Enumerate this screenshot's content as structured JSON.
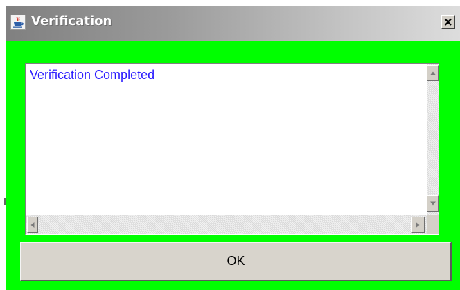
{
  "window": {
    "title": "Verification",
    "icon": "java-cup-icon",
    "background_color": "#00ff00"
  },
  "titlebar": {
    "close_label": "×",
    "close_icon": "close-icon"
  },
  "message": {
    "text": "Verification Completed",
    "color": "#2a1bff"
  },
  "scrollbars": {
    "up_icon": "arrow-up-icon",
    "down_icon": "arrow-down-icon",
    "left_icon": "arrow-left-icon",
    "right_icon": "arrow-right-icon"
  },
  "buttons": {
    "ok_label": "OK"
  }
}
